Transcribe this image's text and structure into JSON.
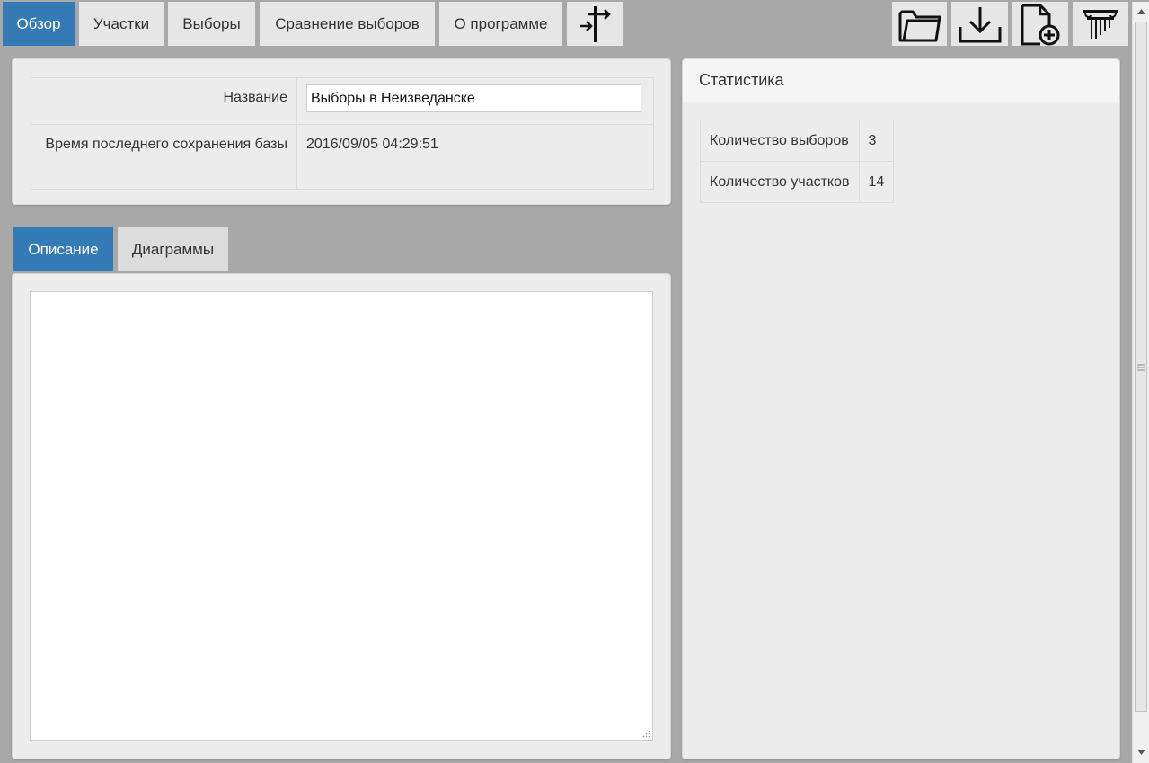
{
  "nav": {
    "tabs": [
      {
        "label": "Обзор",
        "active": true
      },
      {
        "label": "Участки",
        "active": false
      },
      {
        "label": "Выборы",
        "active": false
      },
      {
        "label": "Сравнение выборов",
        "active": false
      },
      {
        "label": "О программе",
        "active": false
      }
    ],
    "icons": [
      "signpost-icon",
      "open-folder-icon",
      "download-icon",
      "new-file-icon",
      "column-icon"
    ]
  },
  "info": {
    "name_label": "Название",
    "name_value": "Выборы в Неизведанске",
    "saved_label": "Время последнего сохранения базы",
    "saved_value": "2016/09/05 04:29:51"
  },
  "subtabs": [
    {
      "label": "Описание",
      "active": true
    },
    {
      "label": "Диаграммы",
      "active": false
    }
  ],
  "description": {
    "value": ""
  },
  "stats": {
    "title": "Статистика",
    "rows": [
      {
        "label": "Количество выборов",
        "value": "3"
      },
      {
        "label": "Количество участков",
        "value": "14"
      }
    ]
  },
  "colors": {
    "accent": "#337ab7",
    "background": "#a8a8a8",
    "panel": "#ececec"
  }
}
